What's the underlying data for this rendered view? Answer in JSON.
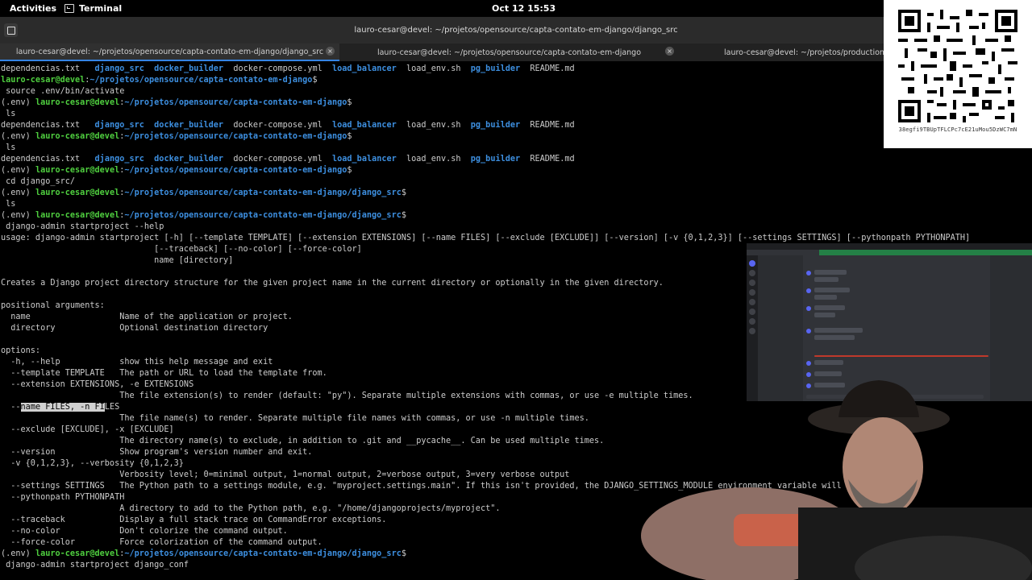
{
  "topbar": {
    "activities": "Activities",
    "app": "Terminal",
    "clock": "Oct 12  15:53"
  },
  "window": {
    "title": "lauro-cesar@devel: ~/projetos/opensource/capta-contato-em-django/django_src"
  },
  "tabs": [
    {
      "label": "lauro-cesar@devel: ~/projetos/opensource/capta-contato-em-django/django_src"
    },
    {
      "label": "lauro-cesar@devel: ~/projetos/opensource/capta-contato-em-django"
    },
    {
      "label": "lauro-cesar@devel: ~/projetos/production/sistem"
    }
  ],
  "prompt": {
    "env": "(.env) ",
    "user": "lauro-cesar@devel",
    "sep": ":",
    "path_base": "~/projetos/opensource/capta-contato-em-django",
    "path_src": "~/projetos/opensource/capta-contato-em-django/django_src",
    "suffix": "$"
  },
  "ls": {
    "dependencias": "dependencias.txt",
    "django_src": "django_src",
    "docker_builder": "docker_builder",
    "docker_compose": "docker-compose.yml",
    "load_balancer": "load_balancer",
    "load_env": "load_env.sh",
    "pg_builder": "pg_builder",
    "readme": "README.md"
  },
  "commands": {
    "source": " source .env/bin/activate",
    "ls": " ls",
    "cd": " cd django_src/",
    "help": " django-admin startproject --help",
    "final": " django-admin startproject django_conf"
  },
  "help": {
    "usage1": "usage: django-admin startproject [-h] [--template TEMPLATE] [--extension EXTENSIONS] [--name FILES] [--exclude [EXCLUDE]] [--version] [-v {0,1,2,3}] [--settings SETTINGS] [--pythonpath PYTHONPATH]",
    "usage2": "                               [--traceback] [--no-color] [--force-color]",
    "usage3": "                               name [directory]",
    "desc": "Creates a Django project directory structure for the given project name in the current directory or optionally in the given directory.",
    "positional_header": "positional arguments:",
    "pos_name": "  name                  Name of the application or project.",
    "pos_dir": "  directory             Optional destination directory",
    "options_header": "options:",
    "opt_h": "  -h, --help            show this help message and exit",
    "opt_template": "  --template TEMPLATE   The path or URL to load the template from.",
    "opt_ext": "  --extension EXTENSIONS, -e EXTENSIONS",
    "opt_ext_desc": "                        The file extension(s) to render (default: \"py\"). Separate multiple extensions with commas, or use -e multiple times.",
    "opt_name_pre": "  --",
    "opt_name_sel": "name FILES, -n FI",
    "opt_name_post": "LES",
    "opt_name_desc": "                        The file name(s) to render. Separate multiple file names with commas, or use -n multiple times.",
    "opt_exclude": "  --exclude [EXCLUDE], -x [EXCLUDE]",
    "opt_exclude_desc": "                        The directory name(s) to exclude, in addition to .git and __pycache__. Can be used multiple times.",
    "opt_version": "  --version             Show program's version number and exit.",
    "opt_verbosity": "  -v {0,1,2,3}, --verbosity {0,1,2,3}",
    "opt_verbosity_desc": "                        Verbosity level; 0=minimal output, 1=normal output, 2=verbose output, 3=very verbose output",
    "opt_settings": "  --settings SETTINGS   The Python path to a settings module, e.g. \"myproject.settings.main\". If this isn't provided, the DJANGO_SETTINGS_MODULE environment variable will be used.",
    "opt_pythonpath": "  --pythonpath PYTHONPATH",
    "opt_pythonpath_desc": "                        A directory to add to the Python path, e.g. \"/home/djangoprojects/myproject\".",
    "opt_traceback": "  --traceback           Display a full stack trace on CommandError exceptions.",
    "opt_nocolor": "  --no-color            Don't colorize the command output.",
    "opt_forcecolor": "  --force-color         Force colorization of the command output."
  },
  "qr": {
    "address": "38egfi9TBUpTFLCPc7cE21uMou5DzWC7mN"
  },
  "colors": {
    "prompt_user": "#4fcf3f",
    "prompt_path": "#3d8fe0",
    "dir": "#3d8fe0",
    "tab_accent": "#3584e4"
  }
}
